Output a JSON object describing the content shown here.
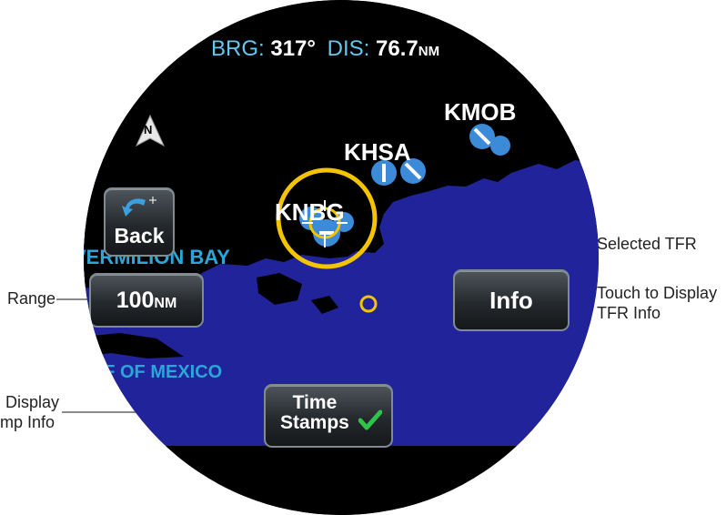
{
  "readout": {
    "brg_label": "BRG:",
    "brg_value": "317°",
    "dis_label": "DIS:",
    "dis_value": "76.7",
    "dis_unit": "NM"
  },
  "map": {
    "north_icon": "north-arrow-icon",
    "airports": [
      "KMOB",
      "KHSA",
      "KNBG"
    ],
    "water_labels": [
      "VERMILION BAY",
      "GULF OF MEXICO"
    ],
    "colors": {
      "water": "#21239a",
      "land": "#000000",
      "airport": "#3b8bd8",
      "tfr": "#f5c400",
      "water_label": "#2aa7d8"
    }
  },
  "buttons": {
    "back_label": "Back",
    "range_value": "100",
    "range_unit": "NM",
    "info_label": "Info",
    "timestamps_line1": "Time",
    "timestamps_line2": "Stamps"
  },
  "callouts": {
    "selected_tfr": "Selected TFR",
    "range": "Range",
    "info_line1": "Touch to Display",
    "info_line2": "TFR Info",
    "ts_line1": "Display",
    "ts_line2": "mp Info"
  }
}
